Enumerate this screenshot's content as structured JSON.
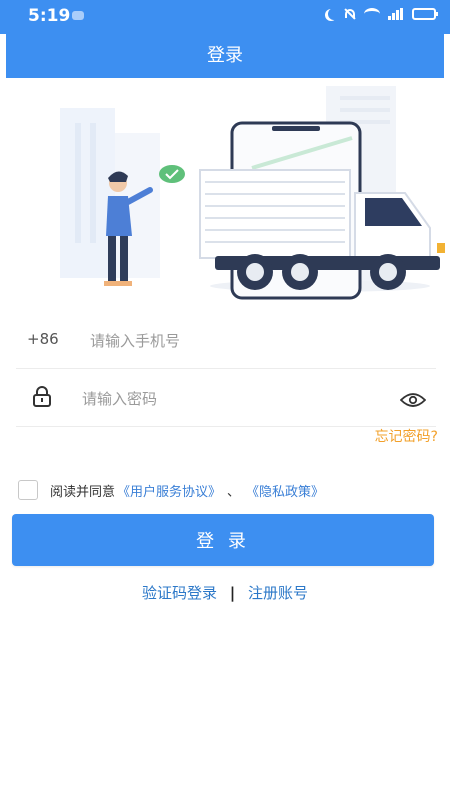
{
  "status_bar": {
    "time": "5:19",
    "icons": [
      "moon-icon",
      "mute-icon",
      "wifi-icon",
      "signal-icon",
      "battery-icon"
    ]
  },
  "header": {
    "title": "登录"
  },
  "hero": {
    "image": "delivery-truck-illustration"
  },
  "form": {
    "country_code": "+86",
    "phone_placeholder": "请输入手机号",
    "phone_value": "",
    "password_placeholder": "请输入密码",
    "password_value": "",
    "forgot_password": "忘记密码?"
  },
  "agreement": {
    "checked": false,
    "prefix": "阅读并同意",
    "user_agreement": "《用户服务协议》",
    "separator": "、",
    "privacy_policy": "《隐私政策》"
  },
  "login_button": "登 录",
  "bottom_links": {
    "sms_login": "验证码登录",
    "divider": "|",
    "register": "注册账号"
  },
  "colors": {
    "primary": "#3d8ff1",
    "link": "#3a7fd6",
    "forgot": "#f2a02a"
  }
}
